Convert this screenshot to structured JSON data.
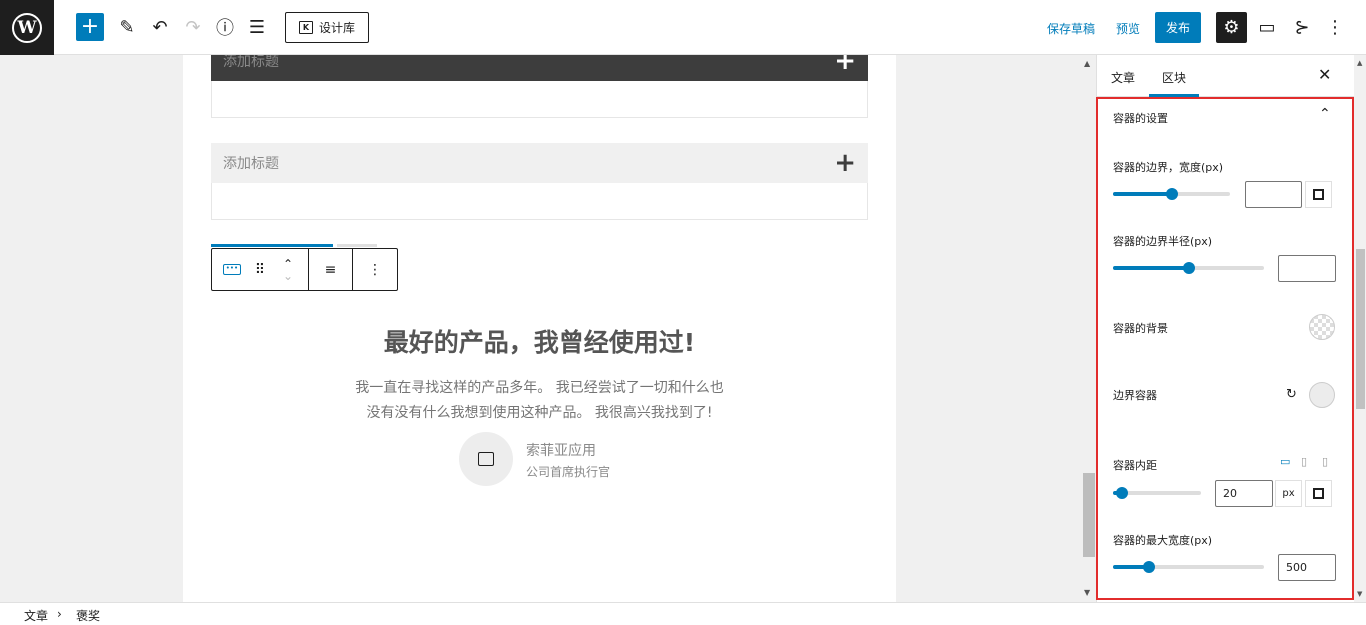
{
  "topbar": {
    "add_label": "+",
    "design_library_label": "设计库",
    "save_draft": "保存草稿",
    "preview": "预览",
    "publish": "发布"
  },
  "canvas": {
    "accordion_1_title": "添加标题",
    "accordion_2_title": "添加标题",
    "testimonial": {
      "title": "最好的产品，我曾经使用过!",
      "line1": "我一直在寻找这样的产品多年。 我已经尝试了一切和什么也",
      "line2": "没有没有什么我想到使用这种产品。 我很高兴我找到了!",
      "name": "索菲亚应用",
      "role": "公司首席执行官"
    }
  },
  "sidebar": {
    "tab_post": "文章",
    "tab_block": "区块",
    "panel_title": "容器的设置",
    "border_width_label": "容器的边界，宽度(px)",
    "border_width": {
      "slider": 0.5,
      "value": ""
    },
    "border_radius_label": "容器的边界半径(px)",
    "border_radius": {
      "slider": 0.5,
      "value": ""
    },
    "background_label": "容器的背景",
    "border_color_label": "边界容器",
    "padding_label": "容器内距",
    "padding": {
      "slider": 0.1,
      "value": "20",
      "unit": "px"
    },
    "max_width_label": "容器的最大宽度(px)",
    "max_width": {
      "slider": 0.24,
      "value": "500"
    }
  },
  "footer": {
    "crumb_1": "文章",
    "separator": "›",
    "crumb_2": "褒奖"
  },
  "colors": {
    "accent": "#007cba",
    "highlight_border": "#e22c2c",
    "dark": "#1e1e1e"
  }
}
